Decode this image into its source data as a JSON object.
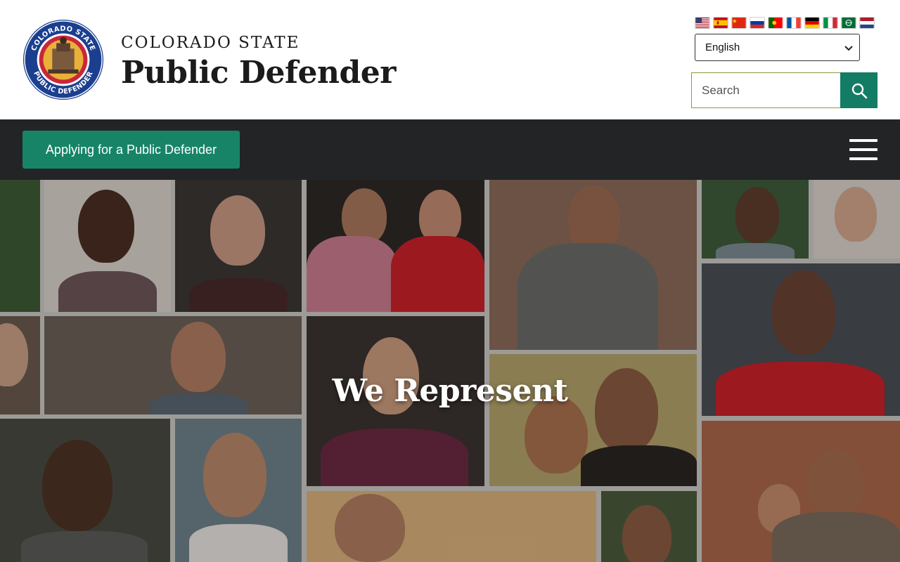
{
  "header": {
    "brand_top": "COLORADO STATE",
    "brand_main": "Public Defender",
    "seal": {
      "ring_top_text": "COLORADO STATE",
      "ring_bottom_text": "PUBLIC DEFENDER",
      "motto": "THAT JUSTICE ESCAPE NONE"
    },
    "flags": [
      "us-flag-icon",
      "spain-flag-icon",
      "china-flag-icon",
      "russia-flag-icon",
      "portugal-flag-icon",
      "france-flag-icon",
      "germany-flag-icon",
      "italy-flag-icon",
      "arabic-flag-icon",
      "netherlands-flag-icon"
    ],
    "language": {
      "selected": "English"
    },
    "search": {
      "placeholder": "Search"
    }
  },
  "nav": {
    "apply_label": "Applying for a Public Defender"
  },
  "hero": {
    "title": "We Represent"
  },
  "colors": {
    "accent": "#178468",
    "nav_bg": "#222426",
    "search_button": "#127c64"
  }
}
